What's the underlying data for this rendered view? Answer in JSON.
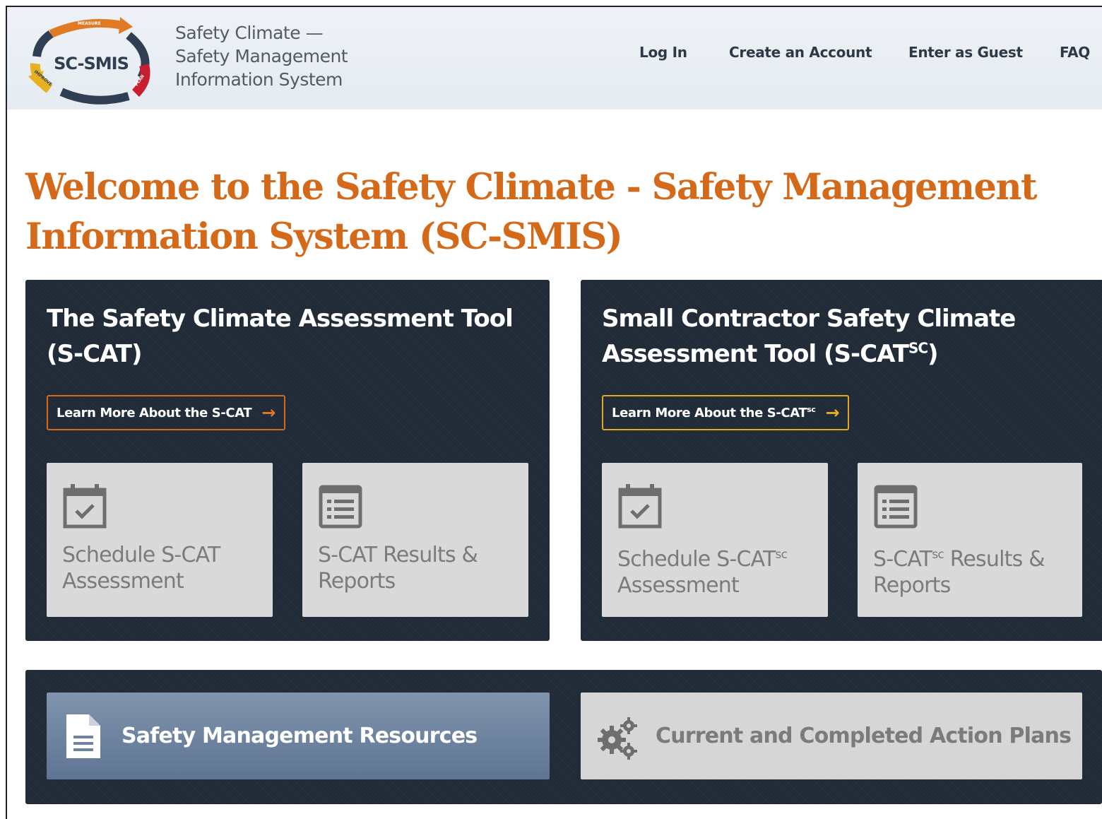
{
  "header": {
    "logo_text": "SC-SMIS",
    "logo_arc_labels": [
      "MEASURE",
      "PLAN",
      "IMPROVE"
    ],
    "site_title_line1": "Safety Climate —",
    "site_title_line2": "Safety Management",
    "site_title_line3": "Information System",
    "nav": {
      "login": "Log In",
      "create_account": "Create an Account",
      "guest": "Enter as Guest",
      "faq": "FAQ"
    }
  },
  "welcome": {
    "line1": "Welcome to the Safety Climate - Safety Management",
    "line2": "Information System (SC-SMIS)"
  },
  "scat_panel": {
    "title_line1": "The Safety Climate Assessment Tool",
    "title_line2": "(S-CAT)",
    "learn_more": "Learn More About the S-CAT",
    "tile_schedule": {
      "line1": "Schedule S-CAT",
      "line2": "Assessment",
      "icon": "calendar-check-icon"
    },
    "tile_results": {
      "line1": "S-CAT Results &",
      "line2": "Reports",
      "icon": "list-icon"
    }
  },
  "scatsc_panel": {
    "title_line1": "Small Contractor Safety Climate",
    "title_line2_prefix": "Assessment Tool (S-CAT",
    "title_sup": "SC",
    "title_line2_suffix": ")",
    "learn_more_prefix": "Learn More About the S-CAT",
    "learn_more_sup": "sc",
    "tile_schedule": {
      "prefix": "Schedule S-CAT",
      "sup": "sc",
      "line2": "Assessment",
      "icon": "calendar-check-icon"
    },
    "tile_results": {
      "prefix": "S-CAT",
      "sup": "sc",
      "suffix": " Results &",
      "line2": "Reports",
      "icon": "list-icon"
    }
  },
  "bottom": {
    "resources": {
      "label": "Safety Management Resources",
      "icon": "document-icon"
    },
    "action_plans": {
      "label": "Current and Completed Action Plans",
      "icon": "gears-icon"
    }
  },
  "colors": {
    "accent_orange": "#d4691a",
    "accent_gold": "#e0a81c",
    "panel_dark": "#1f2a36",
    "tile_grey": "#d9d9d9",
    "button_blue": "#6d829f"
  }
}
